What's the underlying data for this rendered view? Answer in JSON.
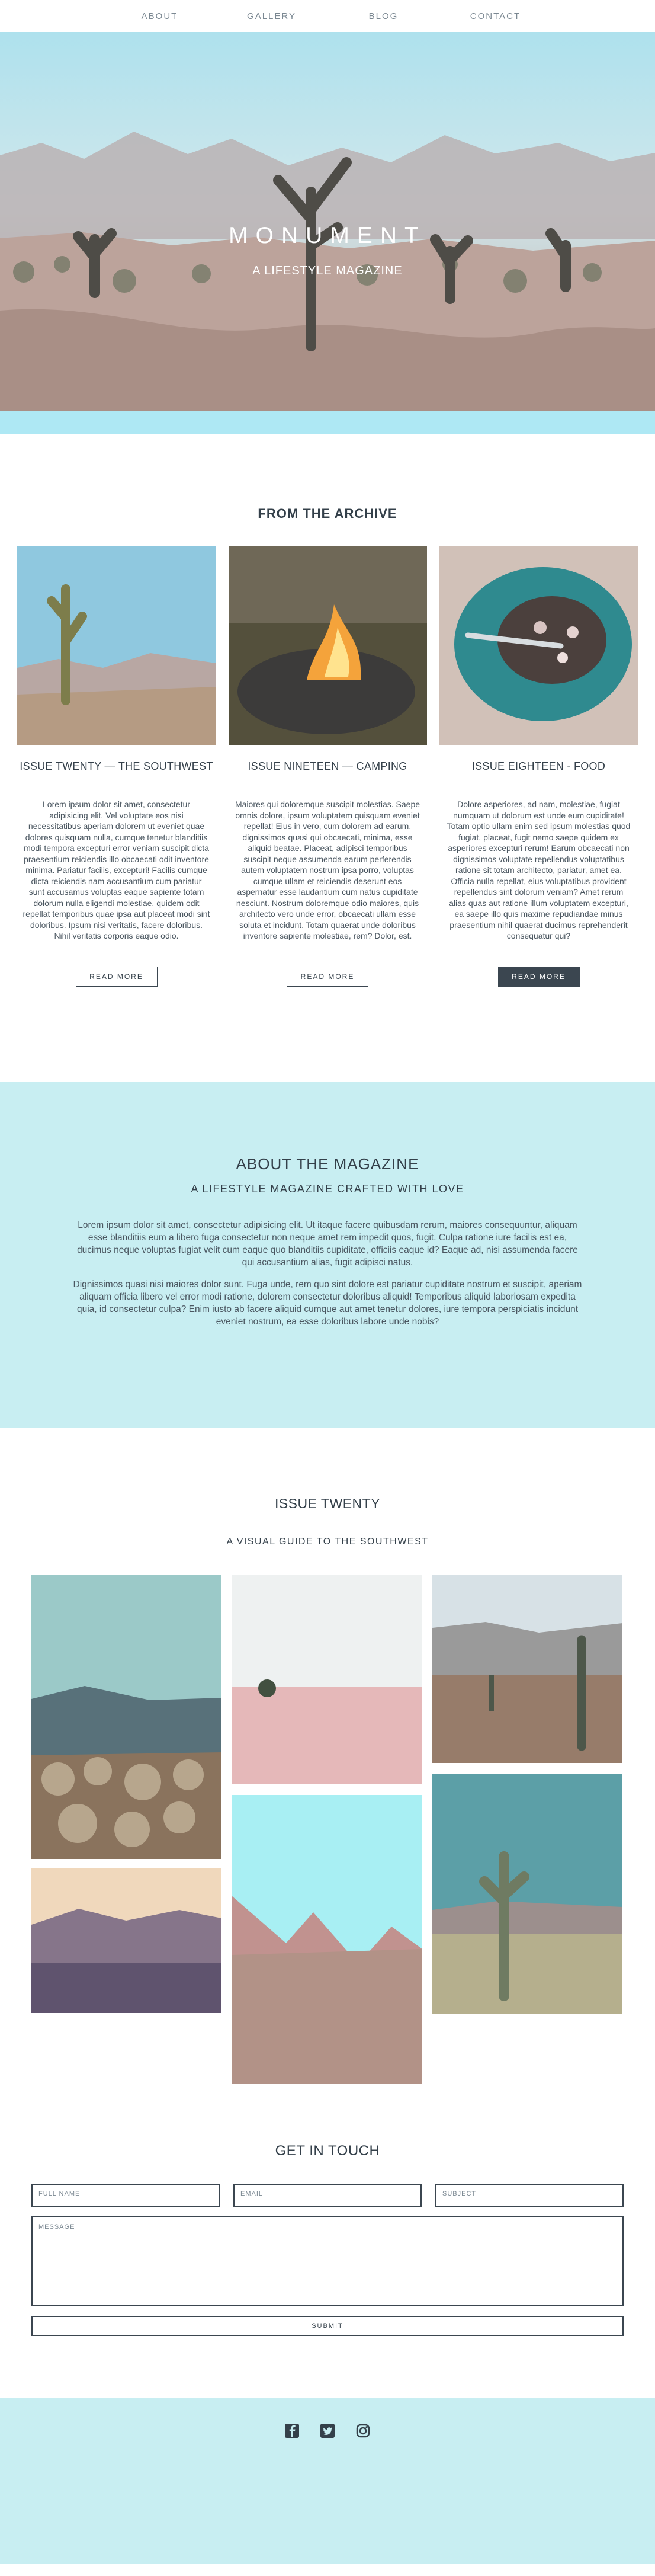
{
  "nav": {
    "about": "ABOUT",
    "gallery": "GALLERY",
    "blog": "BLOG",
    "contact": "CONTACT"
  },
  "hero": {
    "title": "MONUMENT",
    "subtitle": "A LIFESTYLE MAGAZINE"
  },
  "archive": {
    "title": "FROM THE ARCHIVE",
    "cards": [
      {
        "title": "ISSUE TWENTY — THE SOUTHWEST",
        "text": "Lorem ipsum dolor sit amet, consectetur adipisicing elit. Vel voluptate eos nisi necessitatibus aperiam dolorem ut eveniet quae dolores quisquam nulla, cumque tenetur blanditiis modi tempora excepturi error veniam suscipit dicta praesentium reiciendis illo obcaecati odit inventore minima. Pariatur facilis, excepturi! Facilis cumque dicta reiciendis nam accusantium cum pariatur sunt accusamus voluptas eaque sapiente totam dolorum nulla eligendi molestiae, quidem odit repellat temporibus quae ipsa aut placeat modi sint doloribus. Ipsum nisi veritatis, facere doloribus. Nihil veritatis corporis eaque odio.",
        "button": "READ MORE"
      },
      {
        "title": "ISSUE NINETEEN — CAMPING",
        "text": "Maiores qui doloremque suscipit molestias. Saepe omnis dolore, ipsum voluptatem quisquam eveniet repellat! Eius in vero, cum dolorem ad earum, dignissimos quasi qui obcaecati, minima, esse aliquid beatae. Placeat, adipisci temporibus suscipit neque assumenda earum perferendis autem voluptatem nostrum ipsa porro, voluptas cumque ullam et reiciendis deserunt eos aspernatur esse laudantium cum natus cupiditate nesciunt. Nostrum doloremque odio maiores, quis architecto vero unde error, obcaecati ullam esse soluta et incidunt. Totam quaerat unde doloribus inventore sapiente molestiae, rem? Dolor, est.",
        "button": "READ MORE"
      },
      {
        "title": "ISSUE EIGHTEEN - FOOD",
        "text": "Dolore asperiores, ad nam, molestiae, fugiat numquam ut dolorum est unde eum cupiditate! Totam optio ullam enim sed ipsum molestias quod fugiat, placeat, fugit nemo saepe quidem ex asperiores excepturi rerum! Earum obcaecati non dignissimos voluptate repellendus voluptatibus ratione sit totam architecto, pariatur, amet ea. Officia nulla repellat, eius voluptatibus provident repellendus sint dolorum veniam? Amet rerum alias quas aut ratione illum voluptatem excepturi, ea saepe illo quis maxime repudiandae minus praesentium nihil quaerat ducimus reprehenderit consequatur qui?",
        "button": "READ MORE"
      }
    ]
  },
  "about": {
    "title": "ABOUT THE MAGAZINE",
    "subtitle": "A LIFESTYLE MAGAZINE CRAFTED WITH LOVE",
    "p1": "Lorem ipsum dolor sit amet, consectetur adipisicing elit. Ut itaque facere quibusdam rerum, maiores consequuntur, aliquam esse blanditiis eum a libero fuga consectetur non neque amet rem impedit quos, fugit. Culpa ratione iure facilis est ea, ducimus neque voluptas fugiat velit cum eaque quo blanditiis cupiditate, officiis eaque id? Eaque ad, nisi assumenda facere qui accusantium alias, fugit adipisci natus.",
    "p2": "Dignissimos quasi nisi maiores dolor sunt. Fuga unde, rem quo sint dolore est pariatur cupiditate nostrum et suscipit, aperiam aliquam officia libero vel error modi ratione, dolorem consectetur doloribus aliquid! Temporibus aliquid laboriosam expedita quia, id consectetur culpa? Enim iusto ab facere aliquid cumque aut amet tenetur dolores, iure tempora perspiciatis incidunt eveniet nostrum, ea esse doloribus labore unde nobis?"
  },
  "issue": {
    "title": "ISSUE TWENTY",
    "subtitle": "A VISUAL GUIDE TO THE SOUTHWEST"
  },
  "contact": {
    "title": "GET IN TOUCH",
    "full_name": "FULL NAME",
    "email": "EMAIL",
    "subject": "SUBJECT",
    "message": "MESSAGE",
    "submit": "SUBMIT"
  },
  "icons": [
    "facebook-icon",
    "twitter-icon",
    "instagram-icon"
  ],
  "colors": {
    "dark": "#3b4650",
    "light_blue": "#c8eef2",
    "accent_blue": "#aee8f4"
  }
}
